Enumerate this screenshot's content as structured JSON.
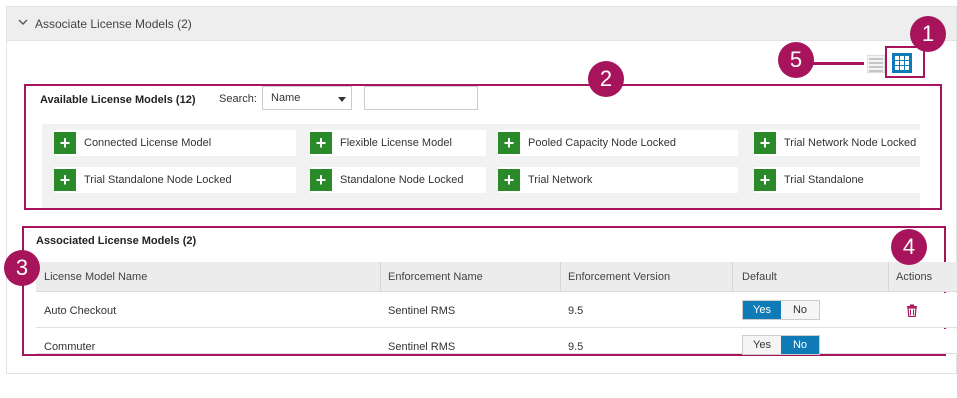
{
  "panel": {
    "title": "Associate License Models (2)"
  },
  "available": {
    "title": "Available License Models (12)",
    "search_label": "Search:",
    "search_select_value": "Name",
    "search_input_value": "",
    "tiles": [
      {
        "label": "Connected License Model"
      },
      {
        "label": "Flexible License Model"
      },
      {
        "label": "Pooled Capacity Node Locked"
      },
      {
        "label": "Trial Network Node Locked"
      },
      {
        "label": "Trial Standalone Node Locked"
      },
      {
        "label": "Standalone Node Locked"
      },
      {
        "label": "Trial Network"
      },
      {
        "label": "Trial Standalone"
      }
    ],
    "tile_icon": "plus-icon",
    "tile_icon_color": "#2a8a2a"
  },
  "associated": {
    "title": "Associated License Models (2)",
    "columns": [
      "License Model Name",
      "Enforcement Name",
      "Enforcement Version",
      "Default",
      "Actions"
    ],
    "rows": [
      {
        "name": "Auto Checkout",
        "enforcement": "Sentinel RMS",
        "version": "9.5",
        "yes": "Yes",
        "no": "No",
        "default": "yes"
      },
      {
        "name": "Commuter",
        "enforcement": "Sentinel RMS",
        "version": "9.5",
        "yes": "Yes",
        "no": "No",
        "default": "no"
      }
    ],
    "action_icon": "trash-icon"
  },
  "callouts": {
    "items": [
      "1",
      "2",
      "3",
      "4",
      "5"
    ],
    "color": "#a8145c"
  },
  "colors": {
    "toggle_active": "#0e7bb6",
    "header_bg": "#eeeeee"
  }
}
